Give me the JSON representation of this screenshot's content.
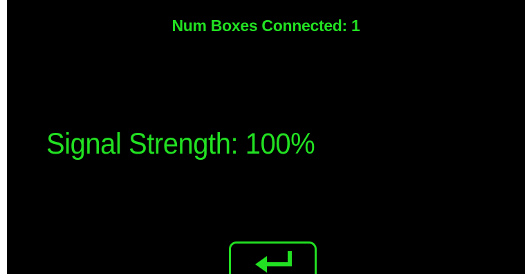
{
  "header": {
    "status_text": "Num Boxes Connected: 1"
  },
  "main": {
    "signal_text": "Signal Strength: 100%"
  },
  "controls": {
    "enter_button": {
      "icon": "enter-return-arrow-icon"
    }
  },
  "colors": {
    "background": "#000000",
    "text": "#22e022",
    "outer_border": "#ffffff"
  }
}
